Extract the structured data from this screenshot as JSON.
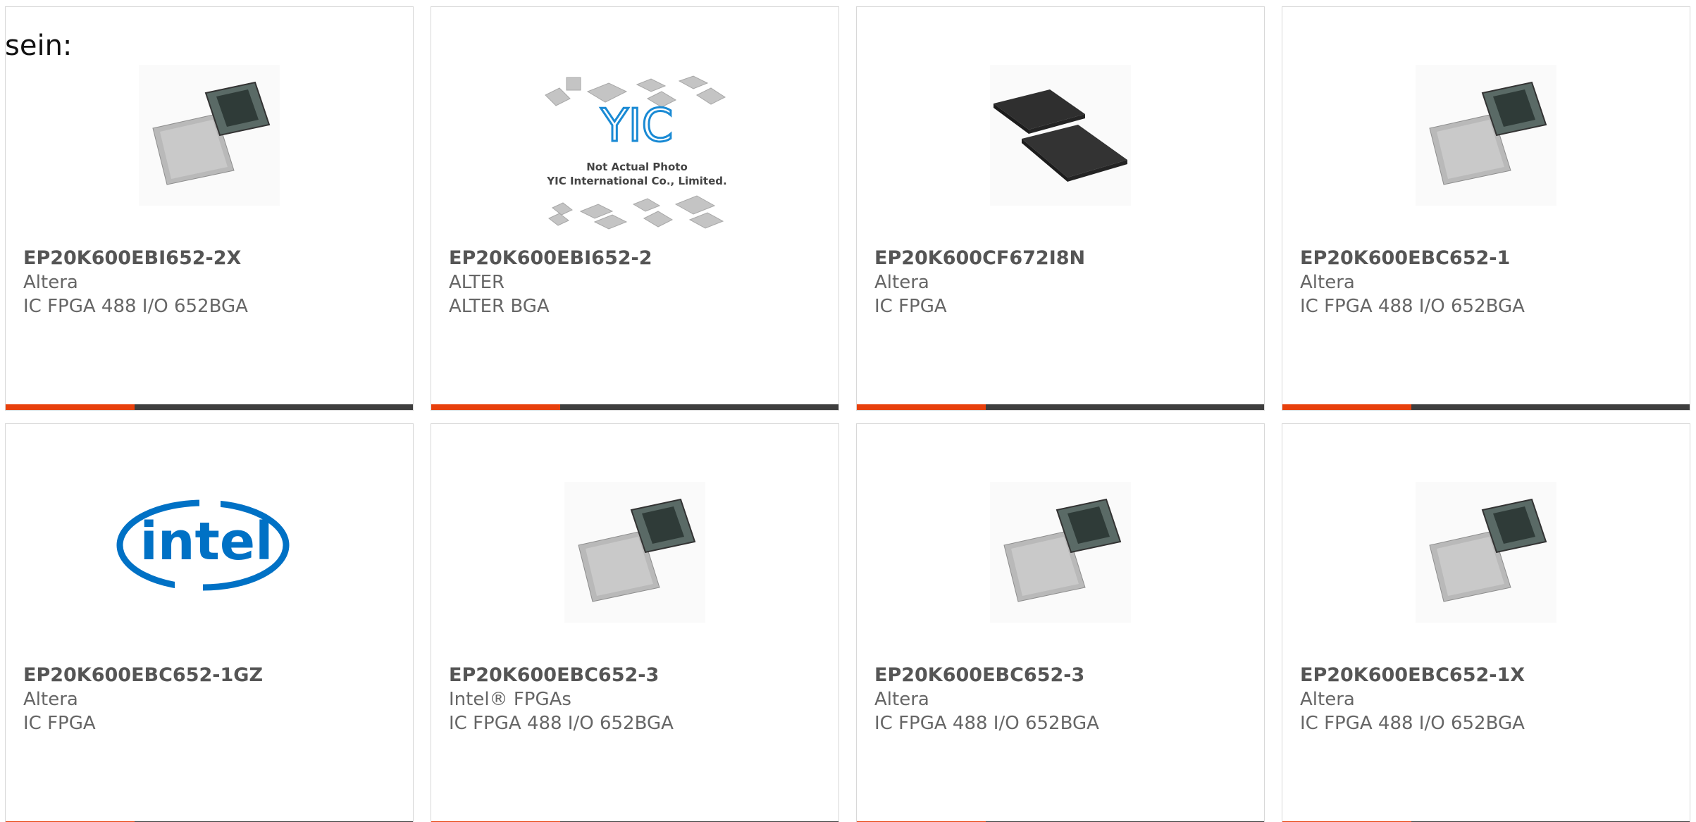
{
  "intro_text": "sein:",
  "colors": {
    "accent": "#e8400c",
    "bar": "#3e3e3e",
    "border": "#d8d8d8",
    "intel_blue": "#0071c5"
  },
  "products": [
    {
      "part_number": "EP20K600EBI652-2X",
      "manufacturer": "Altera",
      "description": "IC FPGA 488 I/O 652BGA",
      "image": "bga-chip-photo"
    },
    {
      "part_number": "EP20K600EBI652-2",
      "manufacturer": "ALTER",
      "description": "ALTER BGA",
      "image": "yic-placeholder",
      "image_text": {
        "logo": "YIC",
        "line1": "Not Actual Photo",
        "line2": "YIC International Co., Limited."
      }
    },
    {
      "part_number": "EP20K600CF672I8N",
      "manufacturer": "Altera",
      "description": "IC FPGA",
      "image": "dark-bga-chips"
    },
    {
      "part_number": "EP20K600EBC652-1",
      "manufacturer": "Altera",
      "description": "IC FPGA 488 I/O 652BGA",
      "image": "bga-chip-photo"
    },
    {
      "part_number": "EP20K600EBC652-1GZ",
      "manufacturer": "Altera",
      "description": "IC FPGA",
      "image": "intel-logo",
      "image_text": {
        "logo": "intel"
      }
    },
    {
      "part_number": "EP20K600EBC652-3",
      "manufacturer": "Intel® FPGAs",
      "description": "IC FPGA 488 I/O 652BGA",
      "image": "bga-chip-photo"
    },
    {
      "part_number": "EP20K600EBC652-3",
      "manufacturer": "Altera",
      "description": "IC FPGA 488 I/O 652BGA",
      "image": "bga-chip-photo"
    },
    {
      "part_number": "EP20K600EBC652-1X",
      "manufacturer": "Altera",
      "description": "IC FPGA 488 I/O 652BGA",
      "image": "bga-chip-photo"
    }
  ]
}
